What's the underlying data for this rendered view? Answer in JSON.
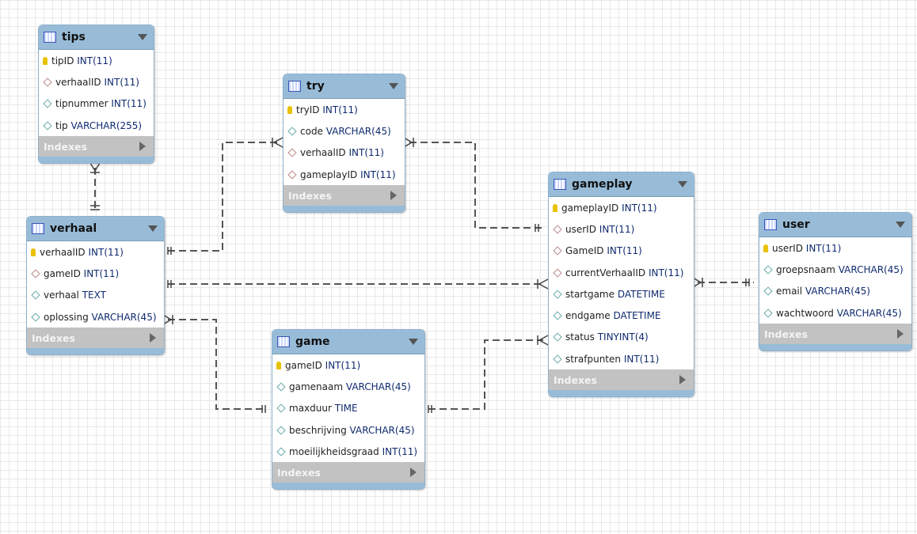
{
  "indexes_label": "Indexes",
  "tables": {
    "tips": {
      "name": "tips",
      "columns": [
        {
          "t": "pk",
          "n": "tipID",
          "ty": "INT(11)"
        },
        {
          "t": "fk",
          "n": "verhaalID",
          "ty": "INT(11)"
        },
        {
          "t": "col",
          "n": "tipnummer",
          "ty": "INT(11)"
        },
        {
          "t": "col",
          "n": "tip",
          "ty": "VARCHAR(255)"
        }
      ]
    },
    "try": {
      "name": "try",
      "columns": [
        {
          "t": "pk",
          "n": "tryID",
          "ty": "INT(11)"
        },
        {
          "t": "col",
          "n": "code",
          "ty": "VARCHAR(45)"
        },
        {
          "t": "fk",
          "n": "verhaalID",
          "ty": "INT(11)"
        },
        {
          "t": "fk",
          "n": "gameplayID",
          "ty": "INT(11)"
        }
      ]
    },
    "verhaal": {
      "name": "verhaal",
      "columns": [
        {
          "t": "pk",
          "n": "verhaalID",
          "ty": "INT(11)"
        },
        {
          "t": "fk",
          "n": "gameID",
          "ty": "INT(11)"
        },
        {
          "t": "col",
          "n": "verhaal",
          "ty": "TEXT"
        },
        {
          "t": "col",
          "n": "oplossing",
          "ty": "VARCHAR(45)"
        }
      ]
    },
    "game": {
      "name": "game",
      "columns": [
        {
          "t": "pk",
          "n": "gameID",
          "ty": "INT(11)"
        },
        {
          "t": "col",
          "n": "gamenaam",
          "ty": "VARCHAR(45)"
        },
        {
          "t": "col",
          "n": "maxduur",
          "ty": "TIME"
        },
        {
          "t": "col",
          "n": "beschrijving",
          "ty": "VARCHAR(45)"
        },
        {
          "t": "col",
          "n": "moeilijkheidsgraad",
          "ty": "INT(11)"
        }
      ]
    },
    "gameplay": {
      "name": "gameplay",
      "columns": [
        {
          "t": "pk",
          "n": "gameplayID",
          "ty": "INT(11)"
        },
        {
          "t": "fk",
          "n": "userID",
          "ty": "INT(11)"
        },
        {
          "t": "fk",
          "n": "GameID",
          "ty": "INT(11)"
        },
        {
          "t": "fk",
          "n": "currentVerhaalID",
          "ty": "INT(11)"
        },
        {
          "t": "col",
          "n": "startgame",
          "ty": "DATETIME"
        },
        {
          "t": "col",
          "n": "endgame",
          "ty": "DATETIME"
        },
        {
          "t": "col",
          "n": "status",
          "ty": "TINYINT(4)"
        },
        {
          "t": "col",
          "n": "strafpunten",
          "ty": "INT(11)"
        }
      ]
    },
    "user": {
      "name": "user",
      "columns": [
        {
          "t": "pk",
          "n": "userID",
          "ty": "INT(11)"
        },
        {
          "t": "col",
          "n": "groepsnaam",
          "ty": "VARCHAR(45)"
        },
        {
          "t": "col",
          "n": "email",
          "ty": "VARCHAR(45)"
        },
        {
          "t": "col",
          "n": "wachtwoord",
          "ty": "VARCHAR(45)"
        }
      ]
    }
  }
}
